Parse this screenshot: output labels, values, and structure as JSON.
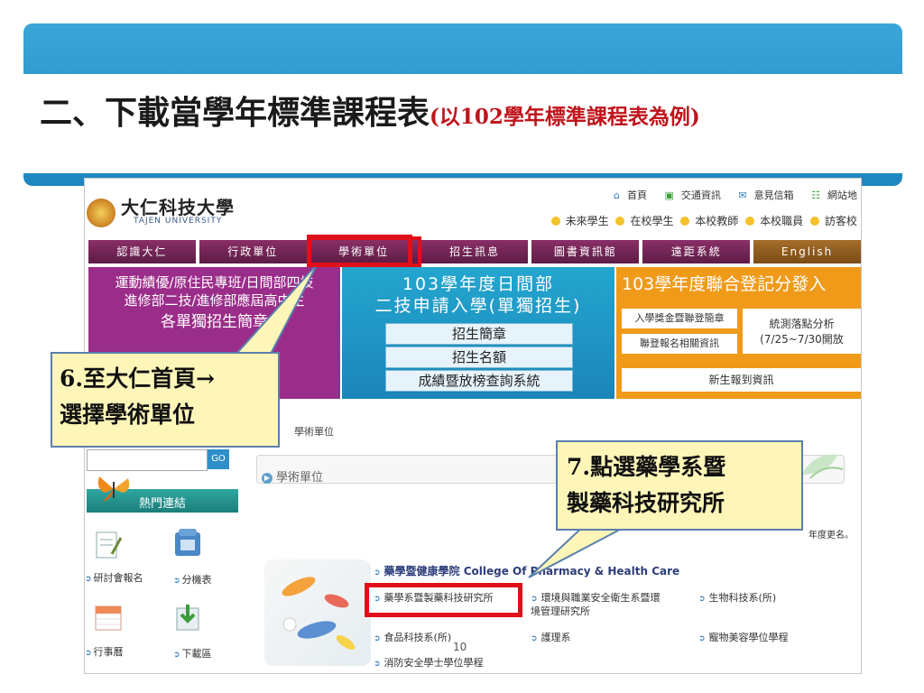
{
  "slide": {
    "title": "二、下載當學年標準課程表",
    "subtitle": "(以102學年標準課程表為例)",
    "page_number": "10"
  },
  "site": {
    "logo_cn": "大仁科技大學",
    "logo_en": "TAJEN UNIVERSITY",
    "top_links": [
      "首頁",
      "交通資訊",
      "意見信箱",
      "網站地"
    ],
    "audience_links": [
      "未來學生",
      "在校學生",
      "本校教師",
      "本校職員",
      "訪客校"
    ],
    "nav_tabs": [
      "認識大仁",
      "行政單位",
      "學術單位",
      "招生訊息",
      "圖書資訊館",
      "遠距系統",
      "English"
    ],
    "hero_left": [
      "運動績優/原住民專班/日間部四技",
      "進修部二技/進修部應屆高中生",
      "各單獨招生簡章"
    ],
    "hero_mid": {
      "line1": "103學年度日間部",
      "line2": "二技申請入學(單獨招生)",
      "buttons": [
        "招生簡章",
        "招生名額",
        "成績暨放榜查詢系統"
      ]
    },
    "hero_right": {
      "title": "103學年度聯合登記分發入",
      "w1": "入學獎金暨聯登簡章",
      "w2": "聯登報名相關資訊",
      "w3a": "統測落點分析",
      "w3b": "(7/25~7/30開放",
      "w4": "新生報到資訊"
    },
    "breadcrumb": "學術單位",
    "search_btn": "GO",
    "section_title": "學術單位",
    "hot_links": "熱門連結",
    "note_text": "年度更名。",
    "icon_labels": [
      "研討會報名",
      "分機表",
      "行事曆",
      "下載區"
    ],
    "college": "藥學暨健康學院 College Of Pharmacy & Health Care",
    "departments": {
      "pharmacy": "藥學系暨製藥科技研究所",
      "env1": "環境與職業安全衛生系暨環",
      "env2": "境管理研究所",
      "bio": "生物科技系(所)",
      "food": "食品科技系(所)",
      "nursing": "護理系",
      "pet": "寵物美容學位學程",
      "fire": "消防安全學士學位學程"
    }
  },
  "callouts": {
    "c6_line1": "6.至大仁首頁→",
    "c6_line2": "選擇學術單位",
    "c7_line1": "7.點選藥學系暨",
    "c7_line2": "製藥科技研究所"
  },
  "colors": {
    "banner": "#1e86bf",
    "nav": "#7a2a5c",
    "hero_left": "#9b2d8a",
    "hero_mid": "#1c85b8",
    "hero_right": "#f09a1a",
    "highlight": "#e0101a",
    "callout_bg": "#fdf6b8",
    "subtitle": "#c0141c"
  }
}
